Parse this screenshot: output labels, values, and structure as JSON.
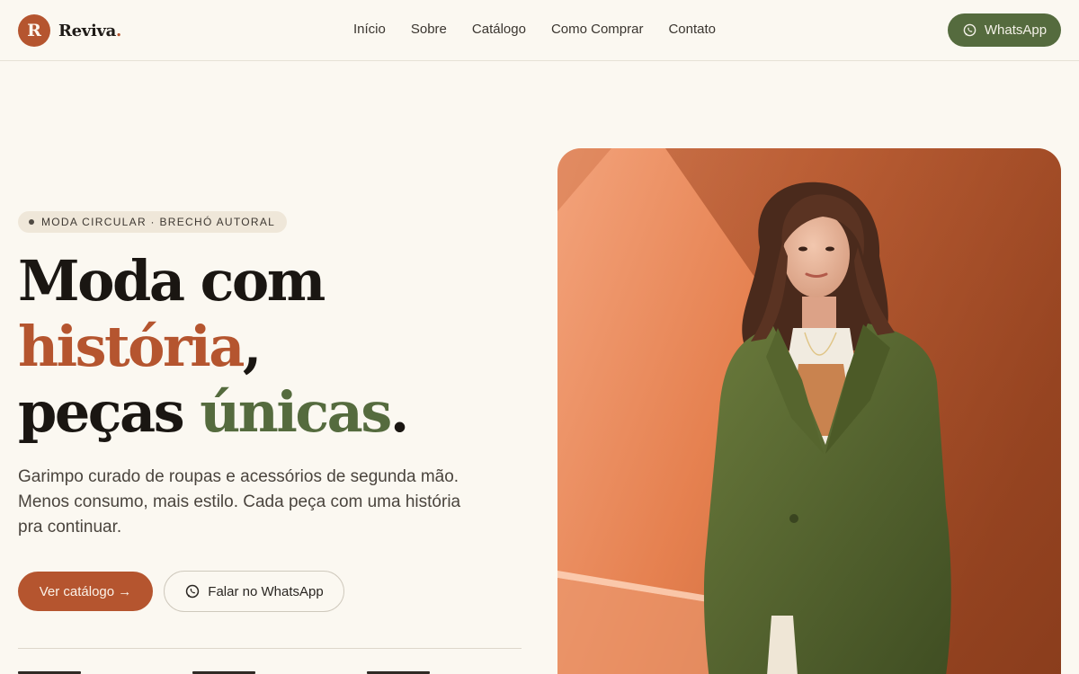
{
  "brand": {
    "logo_letter": "R",
    "name": "Reviva",
    "dot": "."
  },
  "nav": {
    "items": [
      {
        "label": "Início"
      },
      {
        "label": "Sobre"
      },
      {
        "label": "Catálogo"
      },
      {
        "label": "Como Comprar"
      },
      {
        "label": "Contato"
      }
    ]
  },
  "header": {
    "whatsapp_label": "WhatsApp"
  },
  "hero": {
    "eyebrow": "MODA CIRCULAR · BRECHÓ AUTORAL",
    "headline": {
      "line1": "Moda com",
      "line2_accent": "história",
      "line2_rest": ",",
      "line3_start": "peças ",
      "line3_accent": "únicas",
      "line3_end": "."
    },
    "lead": "Garimpo curado de roupas e acessórios de segunda mão. Menos consumo, mais estilo. Cada peça com uma história pra continuar.",
    "primary_cta": "Ver catálogo →",
    "secondary_cta": "Falar no WhatsApp"
  },
  "colors": {
    "background": "#fbf8f1",
    "accent_rust": "#b5552f",
    "accent_olive": "#556b3e",
    "text_dark": "#1a1612"
  },
  "icons": {
    "whatsapp": "whatsapp-icon",
    "bullet": "dot-icon"
  }
}
